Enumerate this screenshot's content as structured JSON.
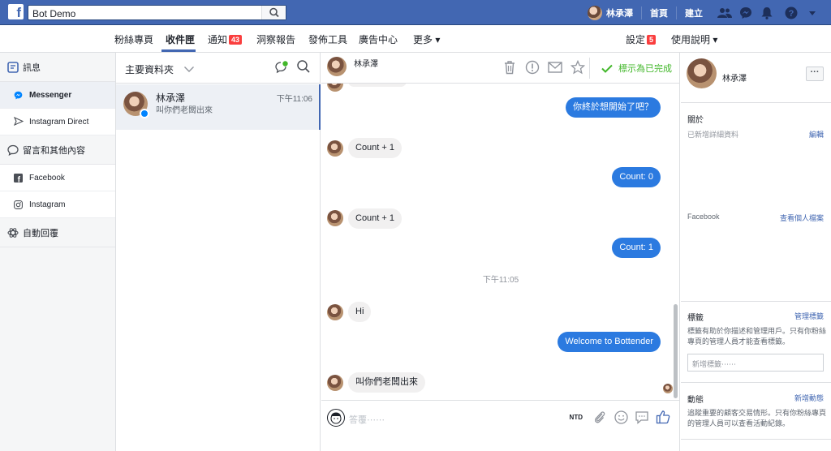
{
  "topbar": {
    "search_value": "Bot Demo",
    "user_name": "林承澤",
    "home_label": "首頁",
    "create_label": "建立"
  },
  "subnav": {
    "items": [
      {
        "label": "粉絲專頁"
      },
      {
        "label": "收件匣"
      },
      {
        "label": "通知",
        "badge": "43"
      },
      {
        "label": "洞察報告"
      },
      {
        "label": "發佈工具"
      },
      {
        "label": "廣告中心"
      },
      {
        "label": "更多 ▾"
      }
    ],
    "settings_label": "設定",
    "settings_badge": "5",
    "help_label": "使用說明 ▾"
  },
  "leftnav": {
    "messages_label": "訊息",
    "messenger_label": "Messenger",
    "instagram_direct_label": "Instagram Direct",
    "comments_label": "留言和其他內容",
    "facebook_label": "Facebook",
    "instagram_label": "Instagram",
    "auto_reply_label": "自動回覆"
  },
  "convlist": {
    "folder_label": "主要資料夾",
    "conversation": {
      "name": "林承澤",
      "snippet": "叫你們老闆出來",
      "time": "下午11:06"
    }
  },
  "thread": {
    "header_name": "林承澤",
    "mark_done_label": "標示為已完成",
    "messages": [
      {
        "dir": "out",
        "text": "你終於想開始了吧？"
      },
      {
        "dir": "in",
        "text": "Count + 1"
      },
      {
        "dir": "out",
        "text": "Count: 0"
      },
      {
        "dir": "in",
        "text": "Count + 1"
      },
      {
        "dir": "out",
        "text": "Count: 1"
      },
      {
        "dir": "in",
        "text": "Hi"
      },
      {
        "dir": "out",
        "text": "Welcome to Bottender"
      },
      {
        "dir": "in",
        "text": "叫你們老闆出來"
      }
    ],
    "timestamp": "下午11:05",
    "composer_placeholder": "答覆⋯⋯",
    "currency_label": "NTD"
  },
  "details": {
    "name": "林承澤",
    "more_label": "···",
    "about_title": "關於",
    "about_sub": "已新增詳細資料",
    "edit_link": "編輯",
    "facebook_label": "Facebook",
    "view_profile_link": "查看個人檔案",
    "tags_title": "標籤",
    "manage_tags_link": "管理標籤",
    "tags_desc": "標籤有助於你描述和管理用戶。只有你粉絲專頁的管理人員才能查看標籤。",
    "tag_input_placeholder": "新增標籤⋯⋯",
    "activity_title": "動態",
    "add_activity_link": "新增動態",
    "activity_desc": "追蹤重要的顧客交易情形。只有你粉絲專頁的管理人員可以查看活動紀錄。"
  },
  "colors": {
    "brand_blue": "#4267b2",
    "bubble_out": "#2b7ae0",
    "bubble_in": "#f1f0f0",
    "done_green": "#42b72a",
    "badge_red": "#fa3e3e"
  }
}
